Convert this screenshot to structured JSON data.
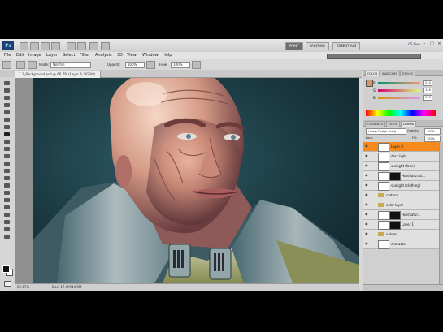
{
  "app": {
    "logo_text": "Ps",
    "workspaces": [
      "PAINT",
      "PAINTING",
      "ESSENTIALS"
    ],
    "active_workspace": 0,
    "cslive": "CS Live"
  },
  "menu": [
    "File",
    "Edit",
    "Image",
    "Layer",
    "Select",
    "Filter",
    "Analysis",
    "3D",
    "View",
    "Window",
    "Help"
  ],
  "options": {
    "mode_label": "Mode:",
    "mode_value": "Normal",
    "opacity_label": "Opacity:",
    "opacity_value": "100%",
    "flow_label": "Flow:",
    "flow_value": "100%"
  },
  "document": {
    "tab_label": "1.1_Background.psd @ 66.7% (Layer 8, RGB/8)",
    "zoom": "66.67%",
    "doc_info": "Doc: 17.6M/44.0M"
  },
  "panels": {
    "color_tabs": [
      "COLOR",
      "SWATCHES",
      "STYLES"
    ],
    "color_channels": [
      {
        "label": "R",
        "value": "214"
      },
      {
        "label": "G",
        "value": "149"
      },
      {
        "label": "B",
        "value": "113"
      }
    ],
    "layer_tabs": [
      "CHANNELS",
      "PATHS",
      "LAYERS"
    ],
    "blend_mode": "Linear Dodge (Add)",
    "opacity_label": "Opacity:",
    "opacity_value": "100%",
    "lock_label": "Lock:",
    "fill_label": "Fill:",
    "fill_value": "100%",
    "layers": [
      {
        "name": "Layer 8",
        "type": "normal",
        "selected": true
      },
      {
        "name": "dark light",
        "type": "normal",
        "selected": false
      },
      {
        "name": "sunlight (face)",
        "type": "normal",
        "selected": false
      },
      {
        "name": "Hue/Saturati...",
        "type": "adjust",
        "selected": false
      },
      {
        "name": "sunlight (clothing)",
        "type": "normal",
        "selected": false
      },
      {
        "name": "cartoon",
        "type": "folder",
        "selected": false
      },
      {
        "name": "color layer",
        "type": "folder",
        "selected": false
      },
      {
        "name": "Hue/Satur...",
        "type": "adjust",
        "selected": false
      },
      {
        "name": "Layer 1",
        "type": "adjust",
        "selected": false
      },
      {
        "name": "values",
        "type": "folder",
        "selected": false
      },
      {
        "name": "character",
        "type": "normal",
        "selected": false
      }
    ]
  },
  "colors": {
    "accent": "#f68a1e",
    "selected_layer": "#f68a1e"
  }
}
